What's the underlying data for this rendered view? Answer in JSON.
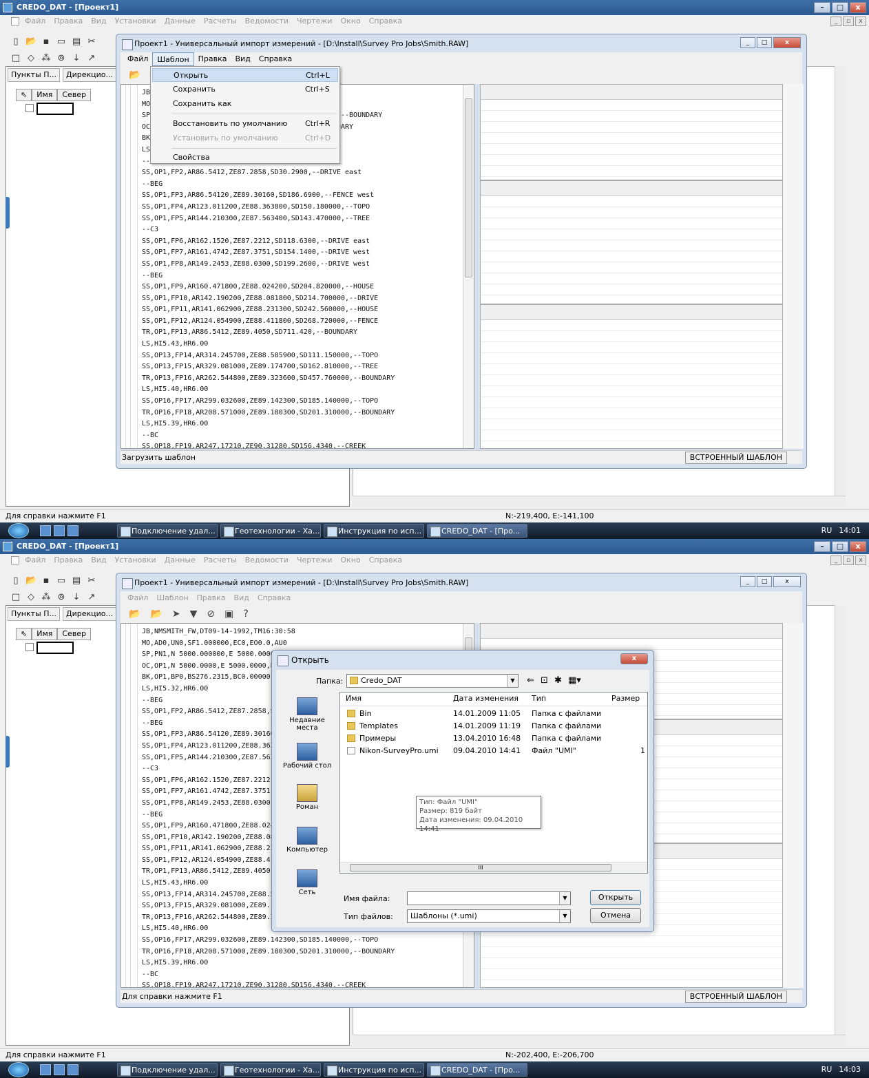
{
  "app": {
    "title": "CREDO_DAT - [Проект1]",
    "menu": [
      "Файл",
      "Правка",
      "Вид",
      "Установки",
      "Данные",
      "Расчеты",
      "Ведомости",
      "Чертежи",
      "Окно",
      "Справка"
    ],
    "tabs": [
      "Пункты П...",
      "Дирекцио..."
    ],
    "grid_headers": [
      "Имя",
      "Север"
    ],
    "status_help": "Для справки нажмите F1"
  },
  "shots": [
    {
      "coords": "N:-219,400, E:-141,100",
      "clock": "14:01",
      "inner_status": "Загрузить шаблон",
      "lines": [
        "JB,NMSMITH_FW,DT09-14-1992,TM16:30:58",
        "MO,AD0,UN0,SF1.000000,EC0,EO0.0,AU0",
        "SP,PN1,N 5000.000000,E 5000.000000,EL100.000000,--BOUNDARY",
        "OC,OP1,N 5000.0000,E 5000.0000,EL100.000,--BOUNDARY",
        "BK,OP1,BP0,BS276.2315,BC0.00000",
        "LS,HI5.32,HR6.00",
        "--BEG",
        "SS,OP1,FP2,AR86.5412,ZE87.2858,SD30.2900,--DRIVE east",
        "--BEG",
        "SS,OP1,FP3,AR86.54120,ZE89.30160,SD186.6900,--FENCE west",
        "SS,OP1,FP4,AR123.011200,ZE88.363800,SD150.180000,--TOPO",
        "SS,OP1,FP5,AR144.210300,ZE87.563400,SD143.470000,--TREE",
        "--C3",
        "SS,OP1,FP6,AR162.1520,ZE87.2212,SD118.6300,--DRIVE east",
        "SS,OP1,FP7,AR161.4742,ZE87.3751,SD154.1400,--DRIVE west",
        "SS,OP1,FP8,AR149.2453,ZE88.0300,SD199.2600,--DRIVE west",
        "--BEG",
        "SS,OP1,FP9,AR160.471800,ZE88.024200,SD204.820000,--HOUSE",
        "SS,OP1,FP10,AR142.190200,ZE88.081800,SD214.700000,--DRIVE",
        "SS,OP1,FP11,AR141.062900,ZE88.231300,SD242.560000,--HOUSE",
        "SS,OP1,FP12,AR124.054900,ZE88.411800,SD268.720000,--FENCE",
        "TR,OP1,FP13,AR86.5412,ZE89.4050,SD711.420,--BOUNDARY",
        "LS,HI5.43,HR6.00",
        "SS,OP13,FP14,AR314.245700,ZE88.585900,SD111.150000,--TOPO",
        "SS,OP13,FP15,AR329.081000,ZE89.174700,SD162.810000,--TREE",
        "TR,OP13,FP16,AR262.544800,ZE89.323600,SD457.760000,--BOUNDARY",
        "LS,HI5.40,HR6.00",
        "SS,OP16,FP17,AR299.032600,ZE89.142300,SD185.140000,--TOPO",
        "TR,OP16,FP18,AR208.571000,ZE89.180300,SD201.310000,--BOUNDARY",
        "LS,HI5.39,HR6.00",
        "--BC",
        "SS,OP18,FP19,AR247.17210,ZE90.31280,SD156.4340,--CREEK"
      ]
    },
    {
      "coords": "N:-202,400, E:-206,700",
      "clock": "14:03",
      "inner_status": "Для справки нажмите F1"
    }
  ],
  "inner_window": {
    "title": "Проект1 - Универсальный импорт измерений - [D:\\Install\\Survey Pro Jobs\\Smith.RAW]",
    "menu": [
      "Файл",
      "Шаблон",
      "Правка",
      "Вид",
      "Справка"
    ],
    "status_right": "ВСТРОЕННЫЙ ШАБЛОН"
  },
  "template_menu": {
    "items": [
      {
        "label": "Открыть",
        "shortcut": "Ctrl+L"
      },
      {
        "label": "Сохранить",
        "shortcut": "Ctrl+S"
      },
      {
        "label": "Сохранить как",
        "shortcut": ""
      },
      {
        "label": "Восстановить по умолчанию",
        "shortcut": "Ctrl+R"
      },
      {
        "label": "Установить по умолчанию",
        "shortcut": "Ctrl+D"
      },
      {
        "label": "Свойства",
        "shortcut": ""
      }
    ]
  },
  "open_dialog": {
    "title": "Открыть",
    "folder_label": "Папка:",
    "folder": "Credo_DAT",
    "places": [
      "Недавние места",
      "Рабочий стол",
      "Роман",
      "Компьютер",
      "Сеть"
    ],
    "columns": [
      "Имя",
      "Дата изменения",
      "Тип",
      "Размер"
    ],
    "files": [
      {
        "name": "Bin",
        "date": "14.01.2009 11:05",
        "type": "Папка с файлами",
        "size": ""
      },
      {
        "name": "Templates",
        "date": "14.01.2009 11:19",
        "type": "Папка с файлами",
        "size": ""
      },
      {
        "name": "Примеры",
        "date": "13.04.2010 16:48",
        "type": "Папка с файлами",
        "size": ""
      },
      {
        "name": "Nikon-SurveyPro.umi",
        "date": "09.04.2010 14:41",
        "type": "Файл \"UMI\"",
        "size": "1"
      }
    ],
    "tooltip": [
      "Тип: Файл \"UMI\"",
      "Размер: 819 байт",
      "Дата изменения: 09.04.2010 14:41"
    ],
    "filename_label": "Имя файла:",
    "filename_value": "",
    "filetype_label": "Тип файлов:",
    "filetype_value": "Шаблоны (*.umi)",
    "open_button": "Открыть",
    "cancel_button": "Отмена"
  },
  "taskbar": {
    "tasks": [
      "Подключение удал...",
      "Геотехнологии - Ха...",
      "Инструкция по исп...",
      "CREDO_DAT - [Про..."
    ],
    "lang": "RU"
  }
}
